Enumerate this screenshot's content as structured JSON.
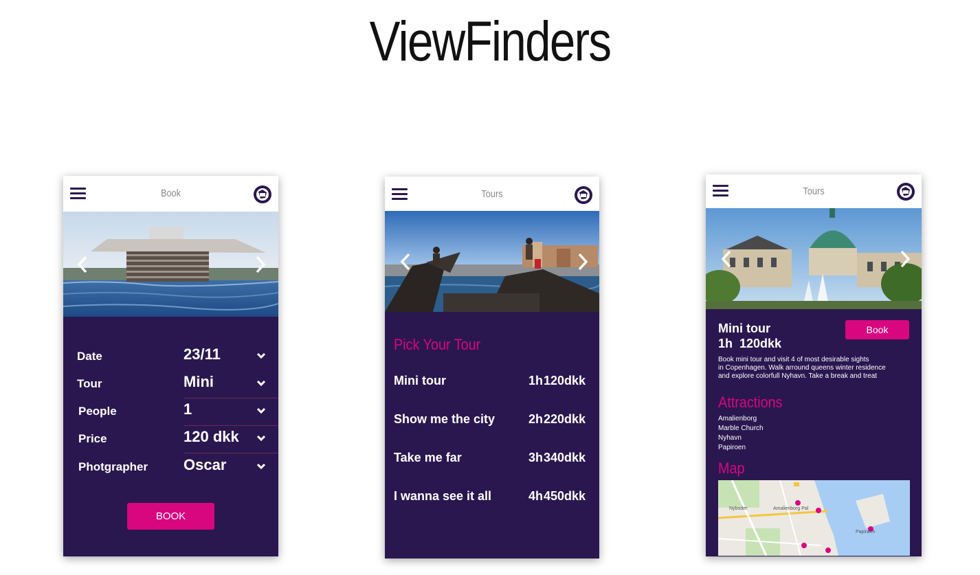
{
  "app": {
    "title": "ViewFinders"
  },
  "colors": {
    "brand_purple": "#2a1750",
    "accent_pink": "#d8077f",
    "header_bg": "#ffffff"
  },
  "screens": [
    {
      "header": {
        "title": "Book",
        "menu_icon": "hamburger-icon",
        "language_icon": "globe-icon"
      },
      "hero": {
        "subject": "Copenhagen Opera House",
        "prev_icon": "chevron-left-icon",
        "next_icon": "chevron-right-icon"
      },
      "form": {
        "rows": [
          {
            "label": "Date",
            "value": "23/11"
          },
          {
            "label": "Tour",
            "value": "Mini"
          },
          {
            "label": "People",
            "value": "1"
          },
          {
            "label": "Price",
            "value": "120 dkk"
          },
          {
            "label": "Photgrapher",
            "value": "Oscar"
          }
        ],
        "submit_label": "BOOK"
      }
    },
    {
      "header": {
        "title": "Tours",
        "menu_icon": "hamburger-icon",
        "language_icon": "globe-icon"
      },
      "hero": {
        "subject": "Harbour sculpture with visitors",
        "prev_icon": "chevron-left-icon",
        "next_icon": "chevron-right-icon"
      },
      "section_title": "Pick Your Tour",
      "tours": [
        {
          "name": "Mini tour",
          "duration": "1h",
          "price": "120dkk"
        },
        {
          "name": "Show me the city",
          "duration": "2h",
          "price": "220dkk"
        },
        {
          "name": "Take me far",
          "duration": "3h",
          "price": "340dkk"
        },
        {
          "name": "I wanna see it all",
          "duration": "4h",
          "price": "450dkk"
        }
      ]
    },
    {
      "header": {
        "title": "Tours",
        "menu_icon": "hamburger-icon",
        "language_icon": "globe-icon"
      },
      "hero": {
        "subject": "Marble Church and Amalienborg fountain",
        "prev_icon": "chevron-left-icon",
        "next_icon": "chevron-right-icon"
      },
      "tour_name": "Mini tour",
      "tour_meta": "1h  120dkk",
      "book_label": "Book",
      "description_lines": [
        "Book mini tour and visit 4 of most desirable sights",
        "in Copenhagen. Walk arround queens winter residence",
        "and explore colorfull Nyhavn. Take a break and treat"
      ],
      "attractions_heading": "Attractions",
      "attractions": [
        "Amalienborg",
        "Marble Church",
        "Nyhavn",
        "Papiroen"
      ],
      "map_heading": "Map",
      "map_labels": [
        "Amalienborg Pal",
        "Nyboder",
        "Papirøen"
      ]
    }
  ]
}
